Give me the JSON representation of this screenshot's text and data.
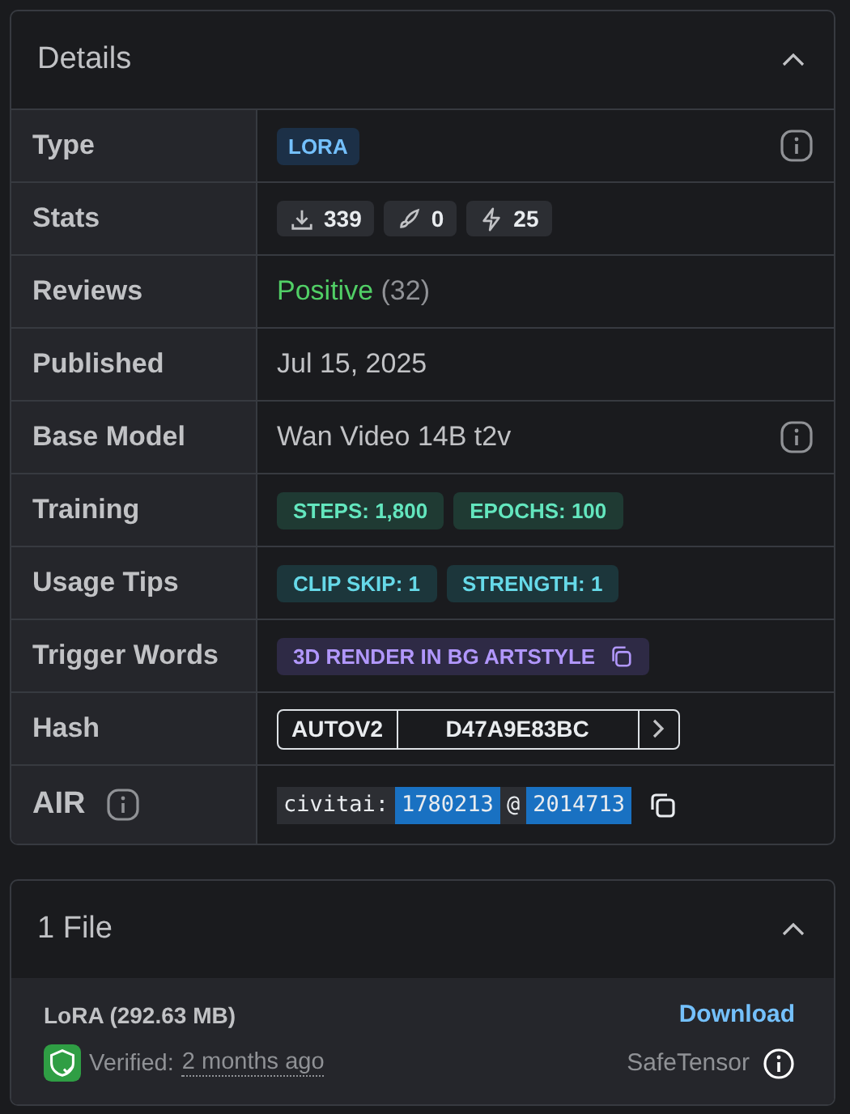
{
  "details": {
    "title": "Details",
    "expanded": true,
    "rows": [
      {
        "label": "Type",
        "kind": "badge",
        "badge": "LORA",
        "info": true
      },
      {
        "label": "Stats",
        "kind": "stats",
        "stats": [
          "339",
          "0",
          "25"
        ]
      },
      {
        "label": "Reviews",
        "kind": "review",
        "rating": "Positive",
        "count": "(32)"
      },
      {
        "label": "Published",
        "kind": "text",
        "value": "Jul 15, 2025"
      },
      {
        "label": "Base Model",
        "kind": "text",
        "value": "Wan Video 14B t2v",
        "info": true
      },
      {
        "label": "Training",
        "kind": "tags",
        "tags": [
          {
            "text": "STEPS: 1,800",
            "kind": "training"
          },
          {
            "text": "EPOCHS: 100",
            "kind": "training"
          }
        ]
      },
      {
        "label": "Usage Tips",
        "kind": "tags",
        "tags": [
          {
            "text": "CLIP SKIP: 1",
            "kind": "tip"
          },
          {
            "text": "STRENGTH: 1",
            "kind": "tip"
          }
        ]
      },
      {
        "label": "Trigger Words",
        "kind": "tags",
        "tags": [
          {
            "text": "3D RENDER IN BG ARTSTYLE",
            "kind": "trigger",
            "copy": true
          }
        ]
      },
      {
        "label": "Hash",
        "kind": "hash",
        "hash_type": "AUTOV2",
        "hash": "D47A9E83BC"
      },
      {
        "label": "AIR",
        "kind": "air",
        "label_info": true,
        "prefix": "civitai:",
        "model_id": "1780213",
        "at": "@",
        "version_id": "2014713"
      }
    ]
  },
  "files": {
    "title": "1 File",
    "expanded": true,
    "items": [
      {
        "name": "LoRA (292.63 MB)",
        "action": "Download",
        "verified": true,
        "verified_label": "Verified:",
        "verified_time": "2 months ago",
        "format": "SafeTensor"
      }
    ]
  }
}
